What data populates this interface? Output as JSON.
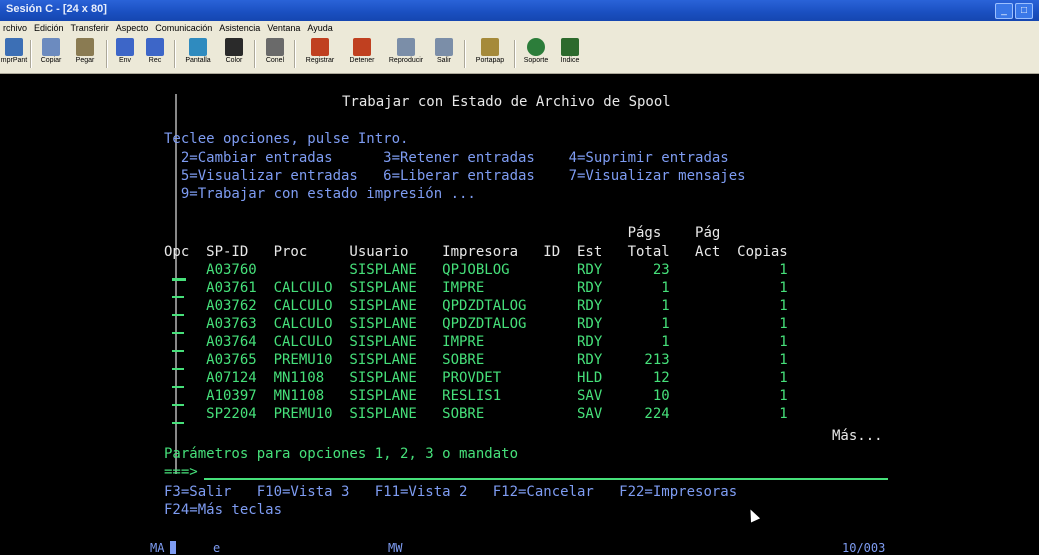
{
  "window": {
    "title": "Sesión C - [24 x 80]"
  },
  "menu": [
    "rchivo",
    "Edición",
    "Transferir",
    "Aspecto",
    "Comunicación",
    "Asistencia",
    "Ventana",
    "Ayuda"
  ],
  "toolbar": [
    {
      "label": "mprPant",
      "icon": "print-screen-icon",
      "color": "#3c6fb5"
    },
    {
      "label": "Copiar",
      "icon": "copy-icon",
      "color": "#6c8bbf"
    },
    {
      "label": "Pegar",
      "icon": "paste-icon",
      "color": "#8a7b52"
    },
    {
      "label": "Env",
      "icon": "send-icon",
      "color": "#3d66c8"
    },
    {
      "label": "Rec",
      "icon": "receive-icon",
      "color": "#3d66c8"
    },
    {
      "label": "Pantalla",
      "icon": "display-icon",
      "color": "#2f8bbf"
    },
    {
      "label": "Color",
      "icon": "color-icon",
      "color": "#2a2a2a"
    },
    {
      "label": "Conel",
      "icon": "connect-icon",
      "color": "#6a6a6a"
    },
    {
      "label": "Registrar",
      "icon": "record-icon",
      "color": "#c04020"
    },
    {
      "label": "Detener",
      "icon": "stop-icon",
      "color": "#c04020"
    },
    {
      "label": "Reproducir",
      "icon": "play-icon",
      "color": "#7b8ea8"
    },
    {
      "label": "Salir",
      "icon": "exit-icon",
      "color": "#7b8ea8"
    },
    {
      "label": "Portapap",
      "icon": "clipboard-icon",
      "color": "#a58a3a"
    },
    {
      "label": "Soporte",
      "icon": "support-globe-icon",
      "color": "#2c7d3a"
    },
    {
      "label": "Indice",
      "icon": "index-book-icon",
      "color": "#2d6a2d"
    }
  ],
  "screen": {
    "title": "Trabajar con Estado de Archivo de Spool",
    "instructions": "Teclee opciones, pulse Intro.",
    "opt_row1": "  2=Cambiar entradas      3=Retener entradas    4=Suprimir entradas",
    "opt_row2": "  5=Visualizar entradas   6=Liberar entradas    7=Visualizar mensajes",
    "opt_row3": "  9=Trabajar con estado impresión ...",
    "header_row1": "                                                       Págs    Pág",
    "header_row2": "Opc  SP-ID   Proc     Usuario    Impresora   ID  Est   Total   Act  Copias",
    "rows": [
      "     A03760           SISPLANE   QPJOBLOG        RDY      23             1",
      "     A03761  CALCULO  SISPLANE   IMPRE           RDY       1             1",
      "     A03762  CALCULO  SISPLANE   QPDZDTALOG      RDY       1             1",
      "     A03763  CALCULO  SISPLANE   QPDZDTALOG      RDY       1             1",
      "     A03764  CALCULO  SISPLANE   IMPRE           RDY       1             1",
      "     A03765  PREMU10  SISPLANE   SOBRE           RDY     213             1",
      "     A07124  MN1108   SISPLANE   PROVDET         HLD      12             1",
      "     A10397  MN1108   SISPLANE   RESLIS1         SAV      10             1",
      "     SP2204  PREMU10  SISPLANE   SOBRE           SAV     224             1"
    ],
    "more": "Más...",
    "params": "Parámetros para opciones 1, 2, 3 o mandato",
    "prompt": "===>",
    "fkeys1": "F3=Salir   F10=Vista 3   F11=Vista 2   F12=Cancelar   F22=Impresoras",
    "fkeys2": "F24=Más teclas"
  },
  "status": {
    "left": "MA",
    "mid1": "e",
    "mid2": "MW",
    "pos": "10/003"
  }
}
